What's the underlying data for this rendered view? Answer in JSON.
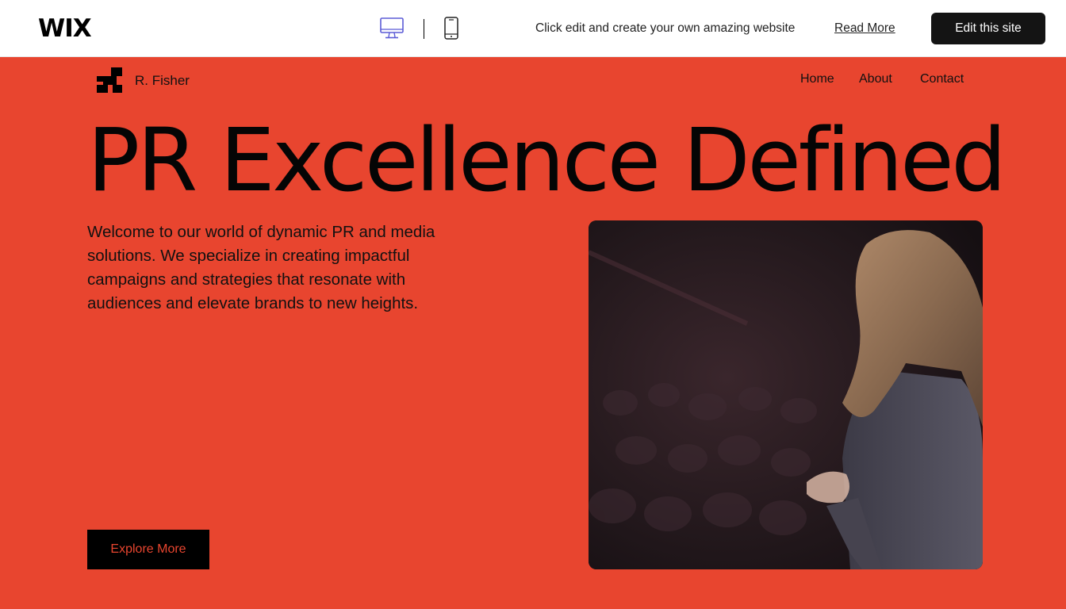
{
  "wix_bar": {
    "logo": "WIX",
    "promo_text": "Click edit and create your own amazing website",
    "read_more": "Read More",
    "edit_button": "Edit this site",
    "accent_color": "#5b5bd6"
  },
  "site": {
    "name": "R. Fisher",
    "nav": [
      "Home",
      "About",
      "Contact"
    ],
    "brand_color": "#e8452f"
  },
  "hero": {
    "title": "PR Excellence Defined",
    "description": "Welcome to our world of dynamic PR and media solutions. We specialize in creating impactful campaigns and strategies that resonate with audiences and elevate brands to new heights.",
    "cta": "Explore More"
  },
  "icons": {
    "desktop": "desktop-icon",
    "mobile": "mobile-icon",
    "logo": "stairs-logo-icon"
  }
}
